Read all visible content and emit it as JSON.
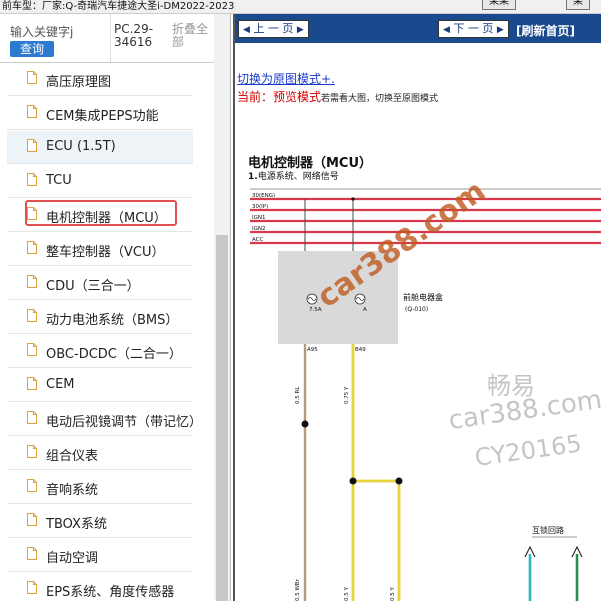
{
  "topbar": {
    "vehicle_text": "前车型：厂家:Q-奇瑞汽车捷途大圣i-DM2022-2023",
    "button_1": "某某",
    "button_2": "某"
  },
  "left": {
    "search_placeholder": "输入关键字j",
    "search_button": "查询",
    "pc_code": "PC.29-34616",
    "collapse_all": "折叠全部",
    "items": [
      {
        "label": "高压原理图"
      },
      {
        "label": "CEM集成PEPS功能"
      },
      {
        "label": "ECU (1.5T)"
      },
      {
        "label": "TCU"
      },
      {
        "label": "电机控制器（MCU）"
      },
      {
        "label": "整车控制器（VCU）"
      },
      {
        "label": "CDU（三合一）"
      },
      {
        "label": "动力电池系统（BMS）"
      },
      {
        "label": "OBC-DCDC（二合一）"
      },
      {
        "label": "CEM"
      },
      {
        "label": "电动后视镜调节（带记忆）"
      },
      {
        "label": "组合仪表"
      },
      {
        "label": "音响系统"
      },
      {
        "label": "TBOX系统"
      },
      {
        "label": "自动空调"
      },
      {
        "label": "EPS系统、角度传感器"
      }
    ]
  },
  "viewer": {
    "prev_page": "上 一 页",
    "next_page": "下 一 页",
    "refresh_home": "[刷新首页]",
    "switch_link": "切换为原图模式+.",
    "current_mode_label": "当前：",
    "current_mode_value": "预览模式",
    "current_mode_hint": "若需看大图，切换至原图模式",
    "diagram": {
      "title": "电机控制器（MCU）",
      "subtitle_num": "1.",
      "subtitle": "电源系统、网络信号",
      "bus_labels": [
        "30(ENG)",
        "30(IP)",
        "IGN1",
        "IGN2",
        "ACC"
      ],
      "fuse_a": "7.5A",
      "fuse_b": "A",
      "fuse_box_name": "前舱电器盒",
      "fuse_box_code": "(Q-010)",
      "pin_a": "A95",
      "pin_b": "B49",
      "wire_a": "0.5 RL",
      "wire_b": "0.75 Y",
      "wire_a2": "0.5 WBr",
      "wire_b2": "0.5 Y",
      "wire_b3": "0.5 Y",
      "interlock": "互锁回路",
      "colors": {
        "bus": "#d8394a",
        "yellow": "#e6d23a",
        "brown": "#a08060",
        "cyan": "#2ab5c0",
        "green": "#2a8a50"
      }
    },
    "watermarks": {
      "wm1": "car388.com",
      "wm2": "畅易",
      "wm3": "car388.com",
      "wm4": "CY20165"
    }
  }
}
